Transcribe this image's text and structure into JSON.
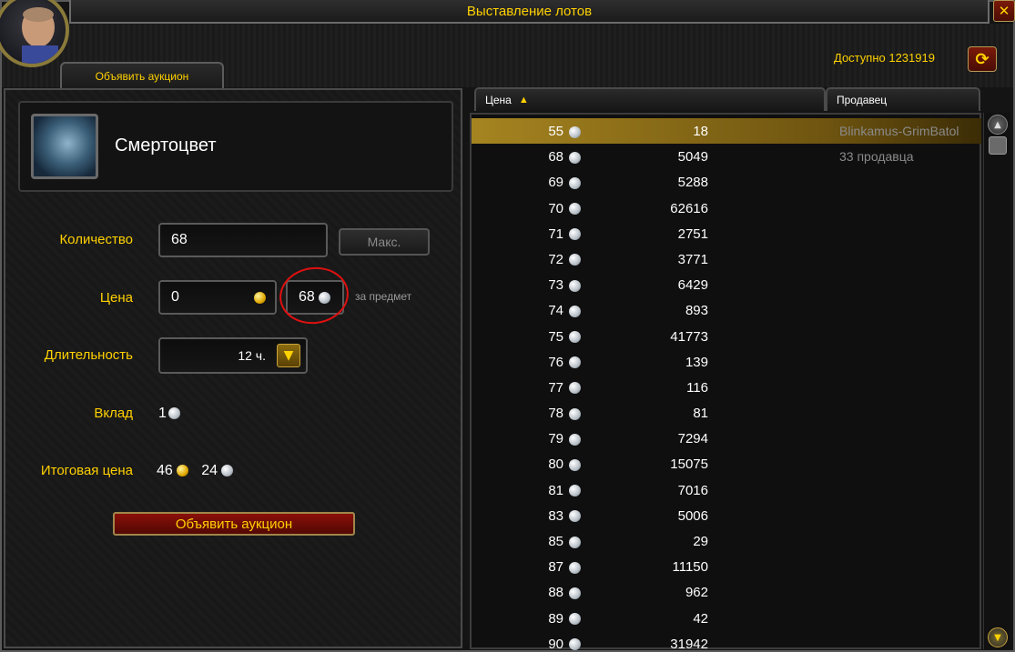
{
  "window": {
    "title": "Выставление лотов",
    "close_label": "✕"
  },
  "tab": {
    "label": "Объявить аукцион"
  },
  "header": {
    "available_label": "Доступно 1231919",
    "refresh_label": "⟳"
  },
  "item": {
    "name": "Смертоцвет",
    "icon": "herb-icon"
  },
  "form": {
    "quantity_label": "Количество",
    "quantity_value": "68",
    "max_label": "Макс.",
    "price_label": "Цена",
    "price_gold": "0",
    "price_silver": "68",
    "per_item_label": "за предмет",
    "duration_label": "Длительность",
    "duration_value": "12 ч.",
    "deposit_label": "Вклад",
    "deposit_value": "1",
    "total_label": "Итоговая цена",
    "total_gold": "46",
    "total_silver": "24",
    "post_label": "Объявить аукцион"
  },
  "columns": {
    "price": "Цена",
    "seller": "Продавец"
  },
  "colors": {
    "accent": "#ffd100",
    "selected_row": "#a58420",
    "annotation": "#e01010"
  },
  "listings": [
    {
      "price": "55",
      "qty": "18",
      "seller": "Blinkamus-GrimBatol"
    },
    {
      "price": "68",
      "qty": "5049",
      "seller": "33 продавца"
    },
    {
      "price": "69",
      "qty": "5288",
      "seller": ""
    },
    {
      "price": "70",
      "qty": "62616",
      "seller": ""
    },
    {
      "price": "71",
      "qty": "2751",
      "seller": ""
    },
    {
      "price": "72",
      "qty": "3771",
      "seller": ""
    },
    {
      "price": "73",
      "qty": "6429",
      "seller": ""
    },
    {
      "price": "74",
      "qty": "893",
      "seller": ""
    },
    {
      "price": "75",
      "qty": "41773",
      "seller": ""
    },
    {
      "price": "76",
      "qty": "139",
      "seller": ""
    },
    {
      "price": "77",
      "qty": "116",
      "seller": ""
    },
    {
      "price": "78",
      "qty": "81",
      "seller": ""
    },
    {
      "price": "79",
      "qty": "7294",
      "seller": ""
    },
    {
      "price": "80",
      "qty": "15075",
      "seller": ""
    },
    {
      "price": "81",
      "qty": "7016",
      "seller": ""
    },
    {
      "price": "83",
      "qty": "5006",
      "seller": ""
    },
    {
      "price": "85",
      "qty": "29",
      "seller": ""
    },
    {
      "price": "87",
      "qty": "11150",
      "seller": ""
    },
    {
      "price": "88",
      "qty": "962",
      "seller": ""
    },
    {
      "price": "89",
      "qty": "42",
      "seller": ""
    },
    {
      "price": "90",
      "qty": "31942",
      "seller": ""
    }
  ]
}
